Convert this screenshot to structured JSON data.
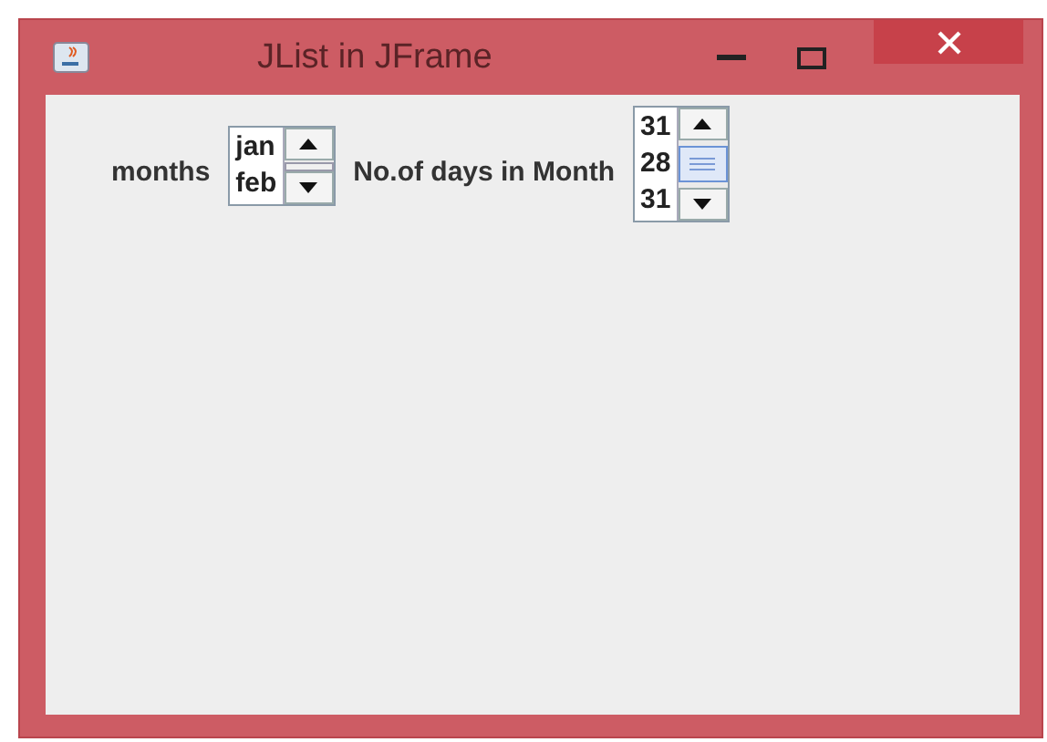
{
  "window": {
    "title": "JList in JFrame"
  },
  "months_label": "months",
  "months_list": {
    "items": [
      "jan",
      "feb"
    ]
  },
  "days_label": "No.of days in Month",
  "days_list": {
    "items": [
      "31",
      "28",
      "31"
    ]
  }
}
